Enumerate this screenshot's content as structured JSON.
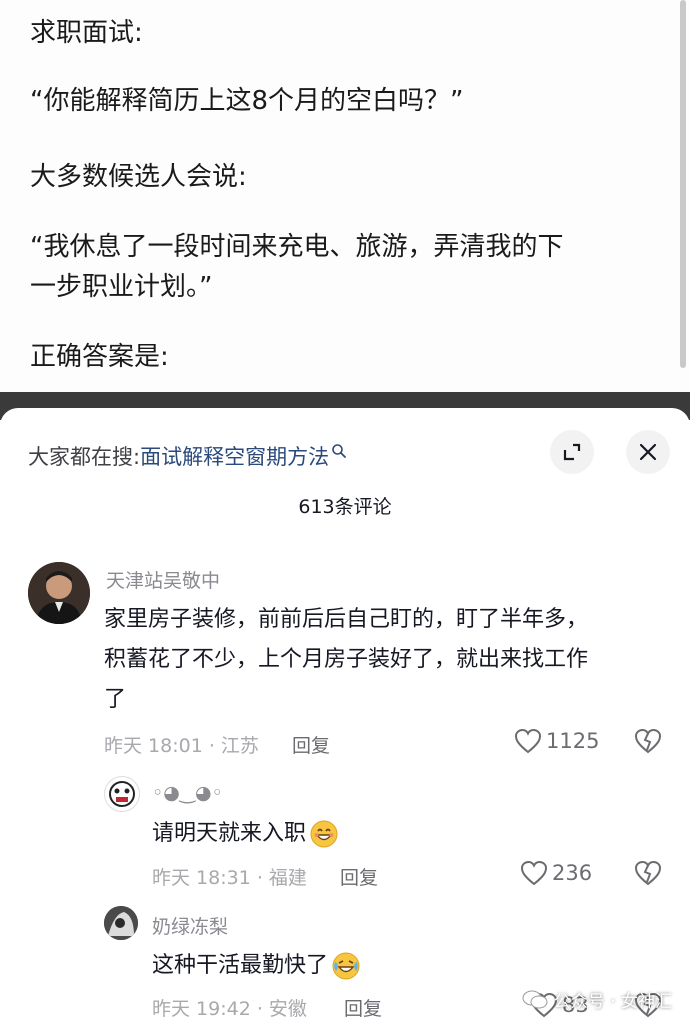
{
  "post": {
    "lines": [
      "求职面试:",
      "“你能解释简历上这8个月的空白吗？”",
      "大多数候选人会说:",
      "“我休息了一段时间来充电、旅游，弄清我的下",
      "一步职业计划。”",
      "正确答案是:"
    ]
  },
  "sheet": {
    "search_prefix": "大家都在搜:",
    "search_term": "面试解释空窗期方法",
    "comment_count": "613条评论",
    "icons": {
      "expand": "expand-icon",
      "close": "close-icon",
      "search": "search-icon"
    }
  },
  "comments": [
    {
      "username": "天津站吴敬中",
      "lines": [
        "家里房子装修，前前后后自己盯的，盯了半年多，",
        "积蓄花了不少，上个月房子装好了，就出来找工作",
        "了"
      ],
      "time_location": "昨天 18:01 · 江苏",
      "reply_label": "回复",
      "likes": "1125"
    },
    {
      "username": "◦◕‿◕◦",
      "text": "请明天就来入职",
      "emoji": "grinning-face-icon",
      "time_location": "昨天 18:31 · 福建",
      "reply_label": "回复",
      "likes": "236"
    },
    {
      "username": "奶绿冻梨",
      "text": "这种干活最勤快了",
      "emoji": "laughing-crying-face-icon",
      "time_location": "昨天 19:42 · 安徽",
      "reply_label": "回复",
      "likes": "83"
    }
  ],
  "watermark": {
    "text": "公众号 · 女神汇"
  },
  "colors": {
    "link": "#2b4a7c",
    "meta": "#a8a8ad",
    "band": "#3a3a3a"
  }
}
